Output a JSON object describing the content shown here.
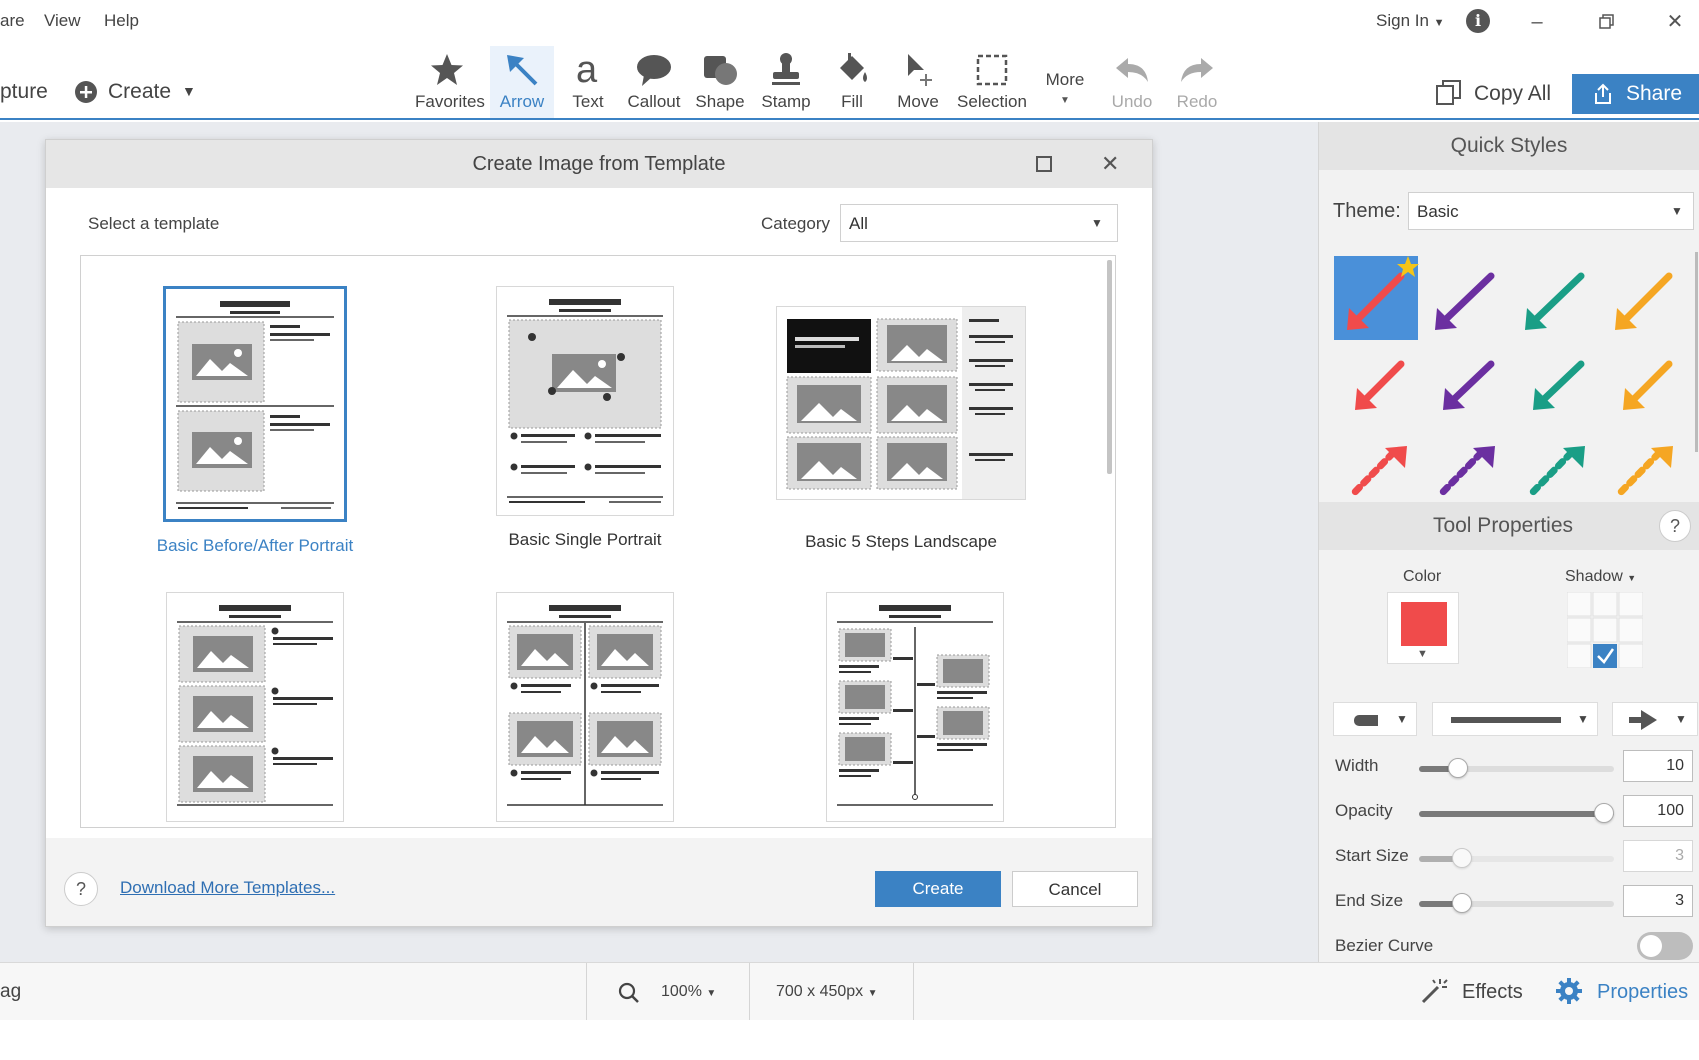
{
  "menu": {
    "items": [
      "are",
      "View",
      "Help"
    ],
    "sign_in": "Sign In",
    "window_controls": [
      "minimize-icon",
      "restore-icon",
      "close-icon"
    ]
  },
  "toolbar": {
    "capture_label": "pture",
    "create_label": "Create",
    "tools": [
      {
        "label": "Favorites",
        "icon": "star-icon"
      },
      {
        "label": "Arrow",
        "icon": "arrow-icon",
        "active": true
      },
      {
        "label": "Text",
        "icon": "text-icon"
      },
      {
        "label": "Callout",
        "icon": "callout-icon"
      },
      {
        "label": "Shape",
        "icon": "shape-icon"
      },
      {
        "label": "Stamp",
        "icon": "stamp-icon"
      },
      {
        "label": "Fill",
        "icon": "fill-icon"
      },
      {
        "label": "Move",
        "icon": "move-icon"
      },
      {
        "label": "Selection",
        "icon": "selection-icon"
      },
      {
        "label": "More",
        "icon": "chevron-down-icon"
      },
      {
        "label": "Undo",
        "icon": "undo-icon",
        "disabled": true
      },
      {
        "label": "Redo",
        "icon": "redo-icon",
        "disabled": true
      }
    ],
    "copy_all_label": "Copy All",
    "share_label": "Share"
  },
  "dialog": {
    "title": "Create Image from Template",
    "select_label": "Select a template",
    "category_label": "Category",
    "category_value": "All",
    "templates": [
      {
        "name": "Basic Before/After Portrait",
        "selected": true
      },
      {
        "name": "Basic Single Portrait"
      },
      {
        "name": "Basic 5 Steps Landscape"
      },
      {
        "name": ""
      },
      {
        "name": ""
      },
      {
        "name": ""
      }
    ],
    "help_label": "?",
    "download_link": "Download More Templates...",
    "create_button": "Create",
    "cancel_button": "Cancel"
  },
  "panel": {
    "quick_styles_title": "Quick Styles",
    "theme_label": "Theme:",
    "theme_value": "Basic",
    "style_colors": [
      "#f04b4b",
      "#6b2fa0",
      "#1a9e86",
      "#f5a623"
    ],
    "tool_properties_title": "Tool Properties",
    "help_label": "?",
    "color_label": "Color",
    "color_value": "#f04b4b",
    "shadow_label": "Shadow",
    "width_label": "Width",
    "width_value": "10",
    "width_fraction": 0.2,
    "opacity_label": "Opacity",
    "opacity_value": "100",
    "opacity_fraction": 1.0,
    "start_size_label": "Start Size",
    "start_size_value": "3",
    "start_size_fraction": 0.22,
    "end_size_label": "End Size",
    "end_size_value": "3",
    "end_size_fraction": 0.22,
    "bezier_label": "Bezier Curve"
  },
  "status": {
    "left_text": "ag",
    "zoom_value": "100%",
    "dimensions_value": "700 x 450px",
    "effects_label": "Effects",
    "properties_label": "Properties"
  }
}
